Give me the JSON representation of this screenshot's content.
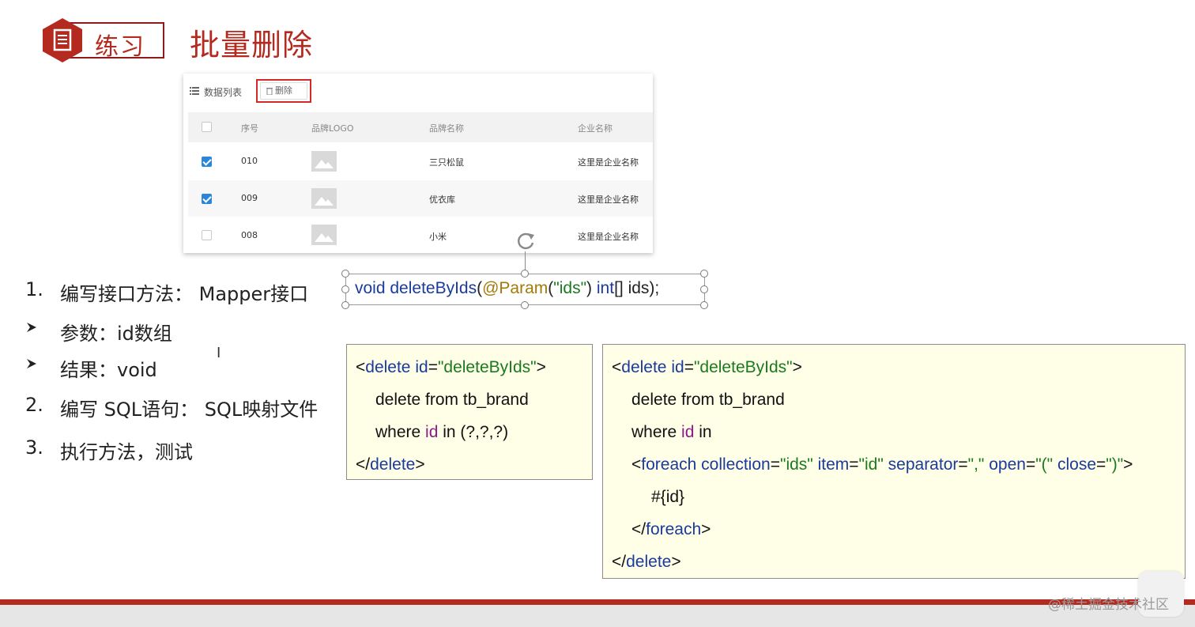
{
  "header": {
    "badge_label": "练习",
    "title": "批量删除"
  },
  "table_screenshot": {
    "list_label": "数据列表",
    "delete_button_label": "删除",
    "columns": [
      "序号",
      "品牌LOGO",
      "品牌名称",
      "企业名称"
    ],
    "rows": [
      {
        "checked": true,
        "id": "010",
        "brand": "三只松鼠",
        "company": "这里是企业名称"
      },
      {
        "checked": true,
        "id": "009",
        "brand": "优衣库",
        "company": "这里是企业名称"
      },
      {
        "checked": false,
        "id": "008",
        "brand": "小米",
        "company": "这里是企业名称"
      }
    ]
  },
  "list": {
    "item1_num": "1.",
    "item1_text": "编写接口方法： Mapper接口",
    "bullet1": "参数：id数组",
    "bullet2": "结果：void",
    "item2_num": "2.",
    "item2_text": "编写 SQL语句： SQL映射文件",
    "item3_num": "3.",
    "item3_text": "执行方法，测试"
  },
  "signature": {
    "t1": "void ",
    "t2": "deleteByIds",
    "t3": "(",
    "t4": "@Param",
    "t5": "(",
    "t6": "\"ids\"",
    "t7": ") ",
    "t8": "int",
    "t9": "[] ids",
    "t10": ");"
  },
  "code_box1": {
    "l1": [
      "<",
      "delete ",
      "id",
      "=",
      "\"deleteByIds\"",
      ">"
    ],
    "l2": "delete from tb_brand",
    "l3": [
      "where ",
      "id",
      " in (?,?,?)"
    ],
    "l4": [
      "</",
      "delete",
      ">"
    ]
  },
  "code_box2": {
    "l1": [
      "<",
      "delete ",
      "id",
      "=",
      "\"deleteByIds\"",
      ">"
    ],
    "l2": "delete from tb_brand",
    "l3": [
      "where ",
      "id",
      " in"
    ],
    "l4": [
      "<",
      "foreach ",
      "collection",
      "=",
      "\"ids\"",
      " ",
      "item",
      "=",
      "\"id\"",
      " ",
      "separator",
      "=",
      "\",\"",
      " ",
      "open",
      "=",
      "\"(\"",
      " ",
      "close",
      "=",
      "\")\"",
      ">"
    ],
    "l5": "#{id}",
    "l6": [
      "</",
      "foreach",
      ">"
    ],
    "l7": [
      "</",
      "delete",
      ">"
    ]
  },
  "watermark": "@稀土掘金技术社区",
  "colors": {
    "accent_red": "#b52a1f",
    "code_bg": "#fffee6",
    "keyword_blue": "#1a3b9c",
    "string_green": "#1a7a1f",
    "annotation_gold": "#a37a0a",
    "checkbox_blue": "#2a86d8"
  }
}
